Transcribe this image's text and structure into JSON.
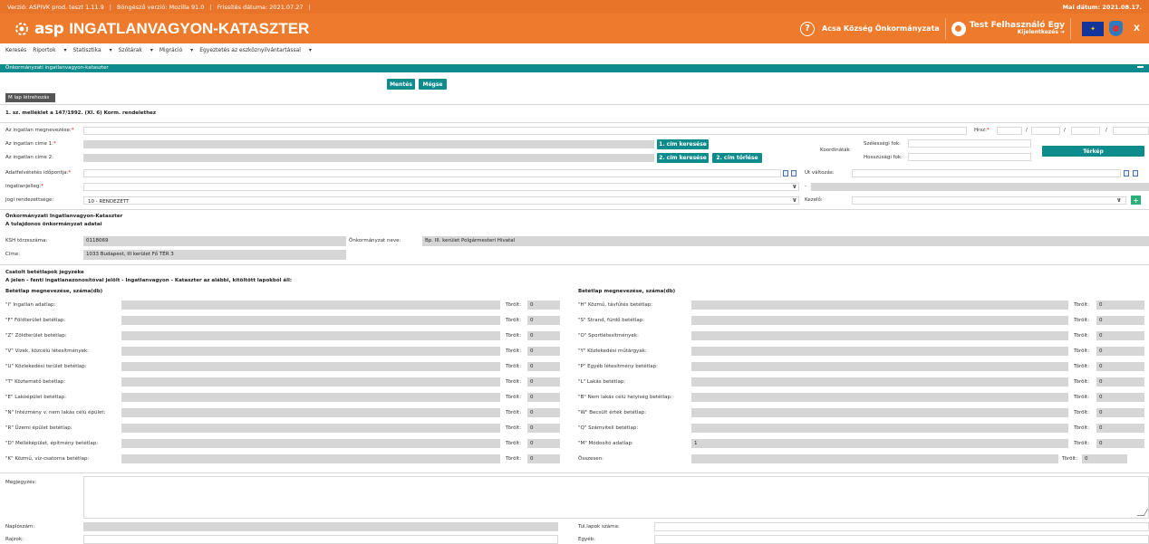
{
  "topbar": {
    "version": "Verzió: ASPIVK prod. teszt 1.11.9",
    "browser": "Böngésző verzió:  Mozilla 91.0",
    "refresh": "Frissítés dátuma: 2021.07.27",
    "date": "Mai dátum: 2021.08.17."
  },
  "header": {
    "logo": "asp",
    "title": "INGATLANVAGYON-KATASZTER",
    "help": "?",
    "org": "Acsa Község Önkormányzata",
    "user": "Test Felhasználó Egy",
    "logout": "Kijelentkezés",
    "close": "X"
  },
  "menu": [
    "Keresés",
    "Riportok",
    "Statisztika",
    "Szótárak",
    "Migráció",
    "Egyeztetés az eszköznyilvántartással"
  ],
  "section_title": "Önkormányzati ingatlanvagyon-kataszter",
  "buttons": {
    "save": "Mentés",
    "cancel": "Mégse",
    "addr1_search": "1. cím keresése",
    "addr2_search": "2. cím keresése",
    "addr2_delete": "2. cím törlése",
    "map": "Térkép",
    "add": "+"
  },
  "tab": "M lap létrehozás",
  "annex": "1. sz. melléklet a 147/1992. (XI. 6) Korm. rendelethez",
  "form": {
    "name_lbl": "Az ingatlan megnevezése:",
    "addr1_lbl": "Az ingatlan címe 1:",
    "addr2_lbl": "Az ingatlan címe 2:",
    "hrsz_lbl": "Hrsz:",
    "slash": "/",
    "coord_lbl": "Koordináták",
    "lat_lbl": "Szélességi fok:",
    "lon_lbl": "Hosszúsági fok:",
    "date_lbl": "Adatfelvétetés időpontja:",
    "change_lbl": "Út változás:",
    "nature_lbl": "Ingatlanjelleg:",
    "dash": "-",
    "legal_lbl": "Jogi rendezettsége:",
    "legal_val": "10 - RENDEZETT",
    "manager_lbl": "Kezelő:"
  },
  "owner": {
    "h1": "Önkormányzati Ingatlanvagyon-Kataszter",
    "h2": "A tulajdonos önkormányzat adatai",
    "ksh_lbl": "KSH törzsszáma:",
    "ksh_val": "0118069",
    "name_lbl": "Önkormányzat neve:",
    "name_val": "Bp. III. kerület Polgármesteri Hivatal",
    "addr_lbl": "Címe:",
    "addr_val": "1033 Budapest, III kerület Fő TÉR 3"
  },
  "sheets": {
    "h1": "Csatolt betétlapok jegyzéke",
    "h2": "A jelen - fenti ingatlanazonosítóval jelölt - Ingatlanvagyon - Kataszter az alábbi, kitöltött lapokból áll:",
    "col_header": "Betétlap megnevezése, száma(db)",
    "deleted_lbl": "Törölt:",
    "left": [
      {
        "n": "\"I\" Ingatlan adatlap:",
        "v": "",
        "d": "0"
      },
      {
        "n": "\"F\" Földterület betétlap:",
        "v": "",
        "d": "0"
      },
      {
        "n": "\"Z\" Zöldterület betétlap:",
        "v": "",
        "d": "0"
      },
      {
        "n": "\"V\" Vizek, közcélú létesítmények:",
        "v": "",
        "d": "0"
      },
      {
        "n": "\"U\" Közlekedési terület betétlap:",
        "v": "",
        "d": "0"
      },
      {
        "n": "\"T\" Köztemető betétlap:",
        "v": "",
        "d": "0"
      },
      {
        "n": "\"E\" Lakóépület betétlap:",
        "v": "",
        "d": "0"
      },
      {
        "n": "\"N\" Intézmény v. nem lakás célú épület:",
        "v": "",
        "d": "0"
      },
      {
        "n": "\"R\" Üzemi épület betétlap:",
        "v": "",
        "d": "0"
      },
      {
        "n": "\"D\" Melléképület, építmény betétlap:",
        "v": "",
        "d": "0"
      },
      {
        "n": "\"K\" Közmű, víz-csatorna betétlap:",
        "v": "",
        "d": "0"
      }
    ],
    "right": [
      {
        "n": "\"H\" Közmű, távfűtés betétlap:",
        "v": "",
        "d": "0"
      },
      {
        "n": "\"S\" Strand, fürdő betétlap:",
        "v": "",
        "d": "0"
      },
      {
        "n": "\"O\" Sportlétesítmények:",
        "v": "",
        "d": "0"
      },
      {
        "n": "\"Y\" Közlekedési műtárgyak:",
        "v": "",
        "d": "0"
      },
      {
        "n": "\"P\" Egyéb létesítmény betétlap:",
        "v": "",
        "d": "0"
      },
      {
        "n": "\"L\" Lakás betétlap:",
        "v": "",
        "d": "0"
      },
      {
        "n": "\"B\" Nem lakás célú helyiség betétlap:",
        "v": "",
        "d": "0"
      },
      {
        "n": "\"W\" Becsült érték betétlap:",
        "v": "",
        "d": "0"
      },
      {
        "n": "\"Q\" Számviteli betétlap:",
        "v": "",
        "d": "0"
      },
      {
        "n": "\"M\" Módosító adatlap:",
        "v": "1",
        "d": "0"
      },
      {
        "n": "Összesen:",
        "v": "",
        "d": "0"
      }
    ]
  },
  "footer": {
    "note_lbl": "Megjegyzés:",
    "journal_lbl": "Naplószám:",
    "pages_lbl": "Tul.lapok száma:",
    "drawings_lbl": "Rajzok:",
    "other_lbl": "Egyéb:"
  }
}
